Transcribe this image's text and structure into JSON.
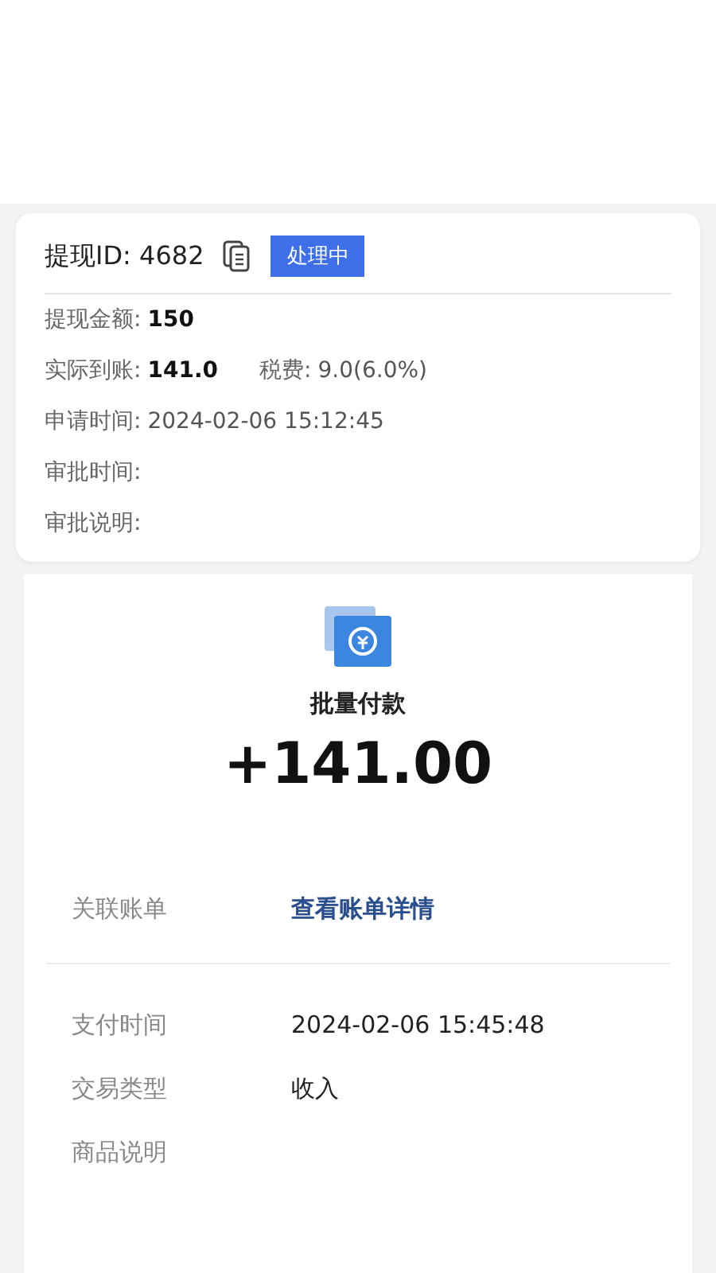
{
  "withdrawal": {
    "id_label": "提现ID:",
    "id": "4682",
    "status": "处理中",
    "rows": [
      {
        "label": "提现金额:",
        "value": "150",
        "bold": true
      },
      {
        "label": "实际到账:",
        "value": "141.0",
        "bold": true,
        "extra_label": "税费:",
        "extra_value": "9.0(6.0%)"
      },
      {
        "label": "申请时间:",
        "value": "2024-02-06 15:12:45",
        "bold": false
      },
      {
        "label": "审批时间:"
      },
      {
        "label": "审批说明:"
      }
    ]
  },
  "payment": {
    "title": "批量付款",
    "amount": "+141.00",
    "link_label": "关联账单",
    "link": "查看账单详情",
    "rows": [
      {
        "label": "支付时间",
        "value": "2024-02-06 15:45:48"
      },
      {
        "label": "交易类型",
        "value": "收入"
      },
      {
        "label": "商品说明"
      }
    ]
  }
}
